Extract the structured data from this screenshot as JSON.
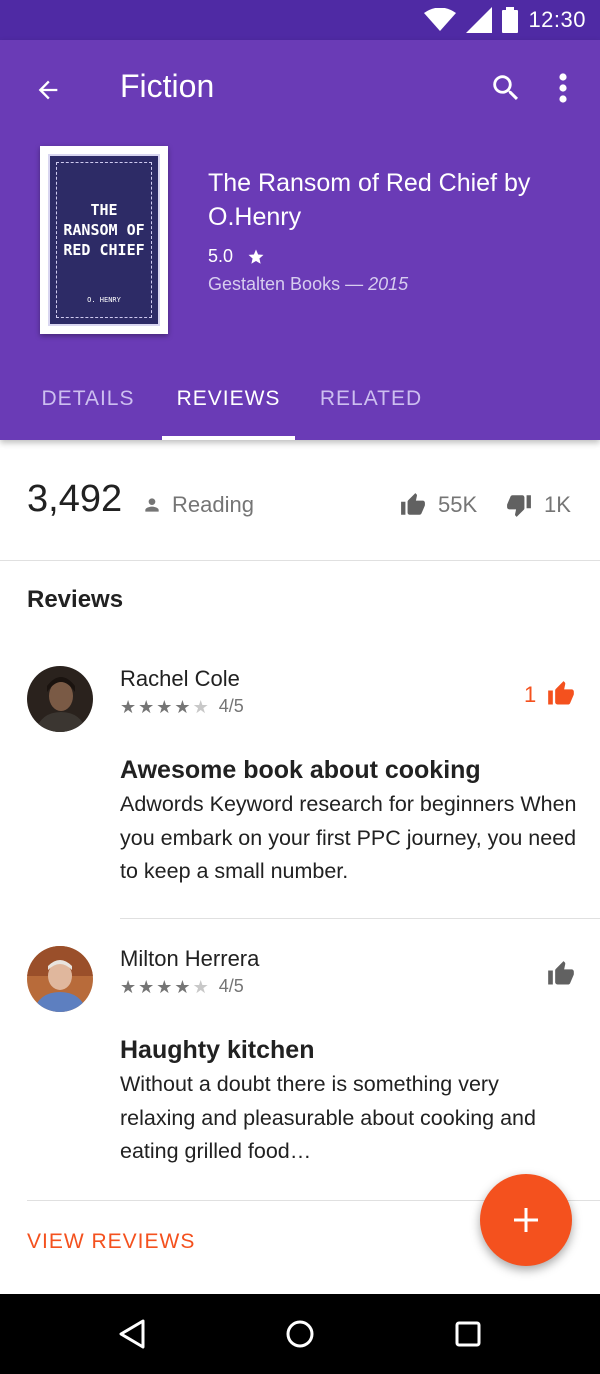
{
  "status_bar": {
    "time": "12:30",
    "icons": [
      "wifi-icon",
      "signal-icon",
      "battery-icon"
    ]
  },
  "app_bar": {
    "title": "Fiction",
    "icons": [
      "arrow-back-icon",
      "search-icon",
      "more-vert-icon"
    ]
  },
  "book": {
    "cover_title": "THE\nRANSOM OF\nRED CHIEF",
    "cover_author": "O. HENRY",
    "title": "The Ransom of Red Chief by O.Henry",
    "rating": "5.0",
    "publisher": "Gestalten Books",
    "separator": " — ",
    "year": "2015"
  },
  "tabs": [
    {
      "label": "DETAILS",
      "active": false
    },
    {
      "label": "REVIEWS",
      "active": true
    },
    {
      "label": "RELATED",
      "active": false
    }
  ],
  "stats": {
    "readers": "3,492",
    "reading_label": "Reading",
    "likes": "55K",
    "dislikes": "1K"
  },
  "reviews_heading": "Reviews",
  "reviews": [
    {
      "name": "Rachel Cole",
      "stars": 4,
      "score": "4/5",
      "like_count": "1",
      "liked": true,
      "title": "Awesome book about cooking",
      "body": "Adwords Keyword research for beginners When you embark on your first PPC journey, you need to keep a small number."
    },
    {
      "name": "Milton Herrera",
      "stars": 4,
      "score": "4/5",
      "like_count": "",
      "liked": false,
      "title": "Haughty kitchen",
      "body": "Without a doubt there is something very relaxing and pleasurable about cooking and eating grilled food…"
    }
  ],
  "view_reviews_label": "VIEW REVIEWS",
  "colors": {
    "primary": "#6a3bb6",
    "primary_dark": "#4f2aa4",
    "accent": "#f4511e"
  }
}
